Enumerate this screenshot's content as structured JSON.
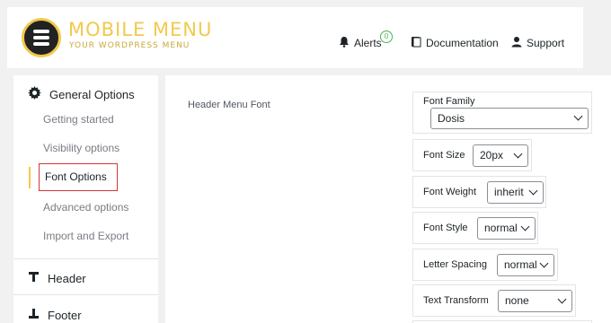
{
  "header": {
    "logo_title": "MOBILE MENU",
    "logo_subtitle": "YOUR WORDPRESS MENU",
    "alerts_label": "Alerts",
    "alerts_count": "0",
    "documentation_label": "Documentation",
    "support_label": "Support"
  },
  "sidebar": {
    "general_options": "General Options",
    "items": [
      "Getting started",
      "Visibility options",
      "Font Options",
      "Advanced options",
      "Import and Export"
    ],
    "header_label": "Header",
    "footer_label": "Footer"
  },
  "main": {
    "section_label": "Header Menu Font",
    "font_family_label": "Font Family",
    "font_family_value": "Dosis",
    "font_size_label": "Font Size",
    "font_size_value": "20px",
    "font_weight_label": "Font Weight",
    "font_weight_value": "inherit",
    "font_style_label": "Font Style",
    "font_style_value": "normal",
    "letter_spacing_label": "Letter Spacing",
    "letter_spacing_value": "normal",
    "text_transform_label": "Text Transform",
    "text_transform_value": "none"
  },
  "colors": {
    "accent_yellow": "#f2c94c",
    "active_border": "#d63638",
    "badge_green": "#46b450"
  }
}
